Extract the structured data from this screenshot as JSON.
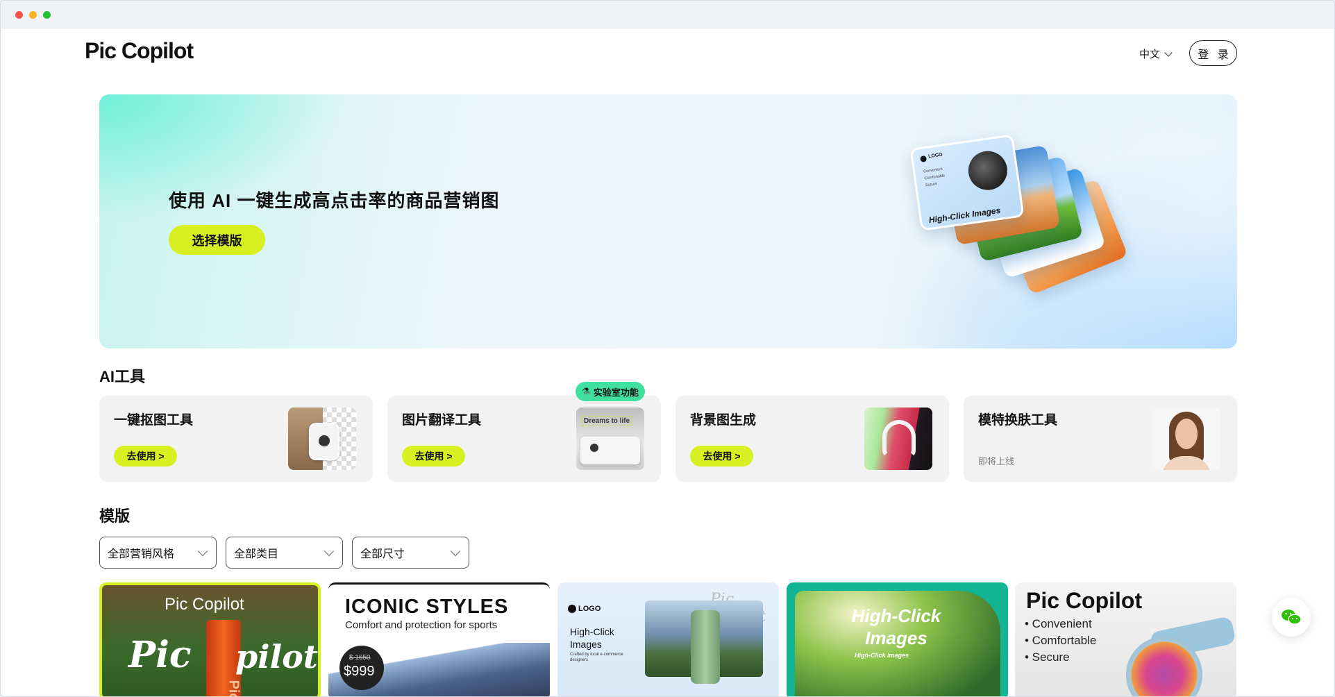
{
  "header": {
    "logo": "Pic Copilot",
    "language": "中文",
    "login": "登 录"
  },
  "hero": {
    "title": "使用 AI 一键生成高点击率的商品营销图",
    "button": "选择模版",
    "card_logo": "LOGO",
    "card_features": [
      "Convenient",
      "Comfortable",
      "Secure"
    ],
    "card_caption": "High-Click Images"
  },
  "ai_tools": {
    "title": "AI工具",
    "lab_badge": "实验室功能",
    "items": [
      {
        "name": "一键抠图工具",
        "action": "去使用 >"
      },
      {
        "name": "图片翻译工具",
        "action": "去使用 >",
        "thumb_text": "Dreams to life"
      },
      {
        "name": "背景图生成",
        "action": "去使用 >"
      },
      {
        "name": "模特换肤工具",
        "status": "即将上线"
      }
    ]
  },
  "templates": {
    "title": "模版",
    "filters": [
      "全部营销风格",
      "全部类目",
      "全部尺寸"
    ],
    "cards": [
      {
        "line1": "Pic Copilot",
        "line2": "Pic",
        "line3": "pilot",
        "vertical": "Pic"
      },
      {
        "title": "ICONIC STYLES",
        "subtitle": "Comfort and protection for sports",
        "old_price": "$ 1650",
        "price": "$999"
      },
      {
        "logo": "LOGO",
        "title": "High-Click Images",
        "small": "Crafted by local e-commerce designers",
        "script": "Pic Copilot"
      },
      {
        "title": "High-Click Images",
        "subtitle": "High-Click Images"
      },
      {
        "title": "Pic Copilot",
        "features": [
          "• Convenient",
          "• Comfortable",
          "• Secure"
        ]
      }
    ]
  },
  "colors": {
    "accent": "#d8f021",
    "lab": "#3fe0a0",
    "wechat": "#2dc100"
  }
}
